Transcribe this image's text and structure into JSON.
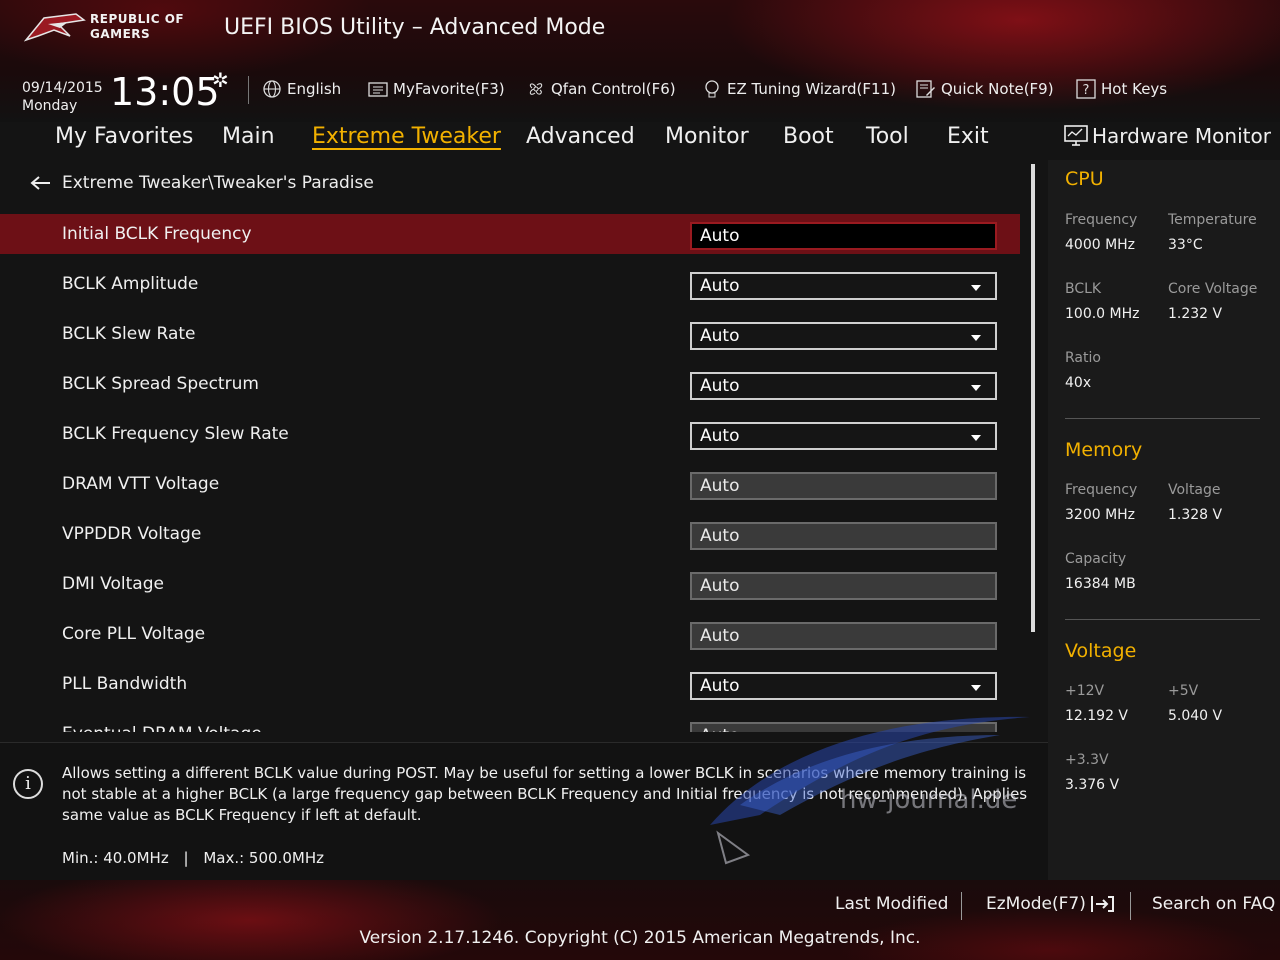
{
  "header": {
    "brand_line1": "REPUBLIC OF",
    "brand_line2": "GAMERS",
    "title": "UEFI BIOS Utility – Advanced Mode",
    "date": "09/14/2015",
    "day": "Monday",
    "time": "13:05",
    "toolbar": {
      "language": "English",
      "myfavorite": "MyFavorite(F3)",
      "qfan": "Qfan Control(F6)",
      "ez_tuning": "EZ Tuning Wizard(F11)",
      "quick_note": "Quick Note(F9)",
      "hot_keys": "Hot Keys"
    }
  },
  "menu": {
    "tabs": [
      {
        "label": "My Favorites"
      },
      {
        "label": "Main"
      },
      {
        "label": "Extreme Tweaker"
      },
      {
        "label": "Advanced"
      },
      {
        "label": "Monitor"
      },
      {
        "label": "Boot"
      },
      {
        "label": "Tool"
      },
      {
        "label": "Exit"
      }
    ],
    "active": "Extreme Tweaker"
  },
  "breadcrumb": "Extreme Tweaker\\Tweaker's Paradise",
  "settings": [
    {
      "label": "Initial BCLK Frequency",
      "value": "Auto",
      "kind": "input"
    },
    {
      "label": "BCLK Amplitude",
      "value": "Auto",
      "kind": "dropdown"
    },
    {
      "label": "BCLK Slew Rate",
      "value": "Auto",
      "kind": "dropdown"
    },
    {
      "label": "BCLK Spread Spectrum",
      "value": "Auto",
      "kind": "dropdown"
    },
    {
      "label": "BCLK Frequency Slew Rate",
      "value": "Auto",
      "kind": "dropdown"
    },
    {
      "label": "DRAM VTT Voltage",
      "value": "Auto",
      "kind": "grey"
    },
    {
      "label": "VPPDDR Voltage",
      "value": "Auto",
      "kind": "grey"
    },
    {
      "label": "DMI Voltage",
      "value": "Auto",
      "kind": "grey"
    },
    {
      "label": "Core PLL Voltage",
      "value": "Auto",
      "kind": "grey"
    },
    {
      "label": "PLL Bandwidth",
      "value": "Auto",
      "kind": "dropdown"
    },
    {
      "label": "Eventual DRAM Voltage",
      "value": "Auto",
      "kind": "grey"
    }
  ],
  "hardware_monitor": {
    "title": "Hardware Monitor",
    "cpu": {
      "heading": "CPU",
      "frequency_label": "Frequency",
      "frequency": "4000 MHz",
      "temperature_label": "Temperature",
      "temperature": "33°C",
      "bclk_label": "BCLK",
      "bclk": "100.0 MHz",
      "core_voltage_label": "Core Voltage",
      "core_voltage": "1.232 V",
      "ratio_label": "Ratio",
      "ratio": "40x"
    },
    "memory": {
      "heading": "Memory",
      "frequency_label": "Frequency",
      "frequency": "3200 MHz",
      "voltage_label": "Voltage",
      "voltage": "1.328 V",
      "capacity_label": "Capacity",
      "capacity": "16384 MB"
    },
    "voltage": {
      "heading": "Voltage",
      "v12_label": "+12V",
      "v12": "12.192 V",
      "v5_label": "+5V",
      "v5": "5.040 V",
      "v33_label": "+3.3V",
      "v33": "3.376 V"
    }
  },
  "info": {
    "text": "Allows setting a different BCLK value during POST. May be useful for setting a lower BCLK in scenarios where memory training is not stable at a higher BCLK (a large frequency gap between BCLK Frequency and Initial frequency is not recommended). Applies same value as BCLK Frequency if left at default.",
    "min": "Min.: 40.0MHz",
    "max": "Max.: 500.0MHz",
    "range_sep": "|"
  },
  "footer": {
    "last_modified": "Last Modified",
    "ezmode": "EzMode(F7)",
    "search_faq": "Search on FAQ",
    "version": "Version 2.17.1246. Copyright (C) 2015 American Megatrends, Inc."
  },
  "watermark": "hw-journal.de",
  "colors": {
    "accent": "#f2b100",
    "selected_row": "#6d1016"
  }
}
